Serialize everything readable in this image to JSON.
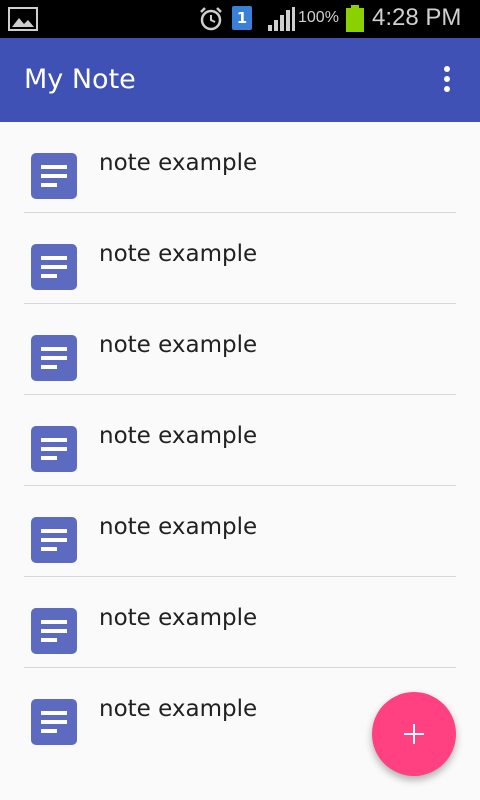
{
  "status_bar": {
    "battery_percent": "100%",
    "time": "4:28 PM",
    "sim_slot": "1",
    "icons": [
      "gallery-icon",
      "alarm-icon",
      "sim-icon",
      "signal-icon",
      "battery-icon"
    ]
  },
  "app_bar": {
    "title": "My Note",
    "overflow_icon": "more-vert-icon"
  },
  "notes": [
    {
      "title": "note example",
      "icon": "note-icon"
    },
    {
      "title": "note example",
      "icon": "note-icon"
    },
    {
      "title": "note example",
      "icon": "note-icon"
    },
    {
      "title": "note example",
      "icon": "note-icon"
    },
    {
      "title": "note example",
      "icon": "note-icon"
    },
    {
      "title": "note example",
      "icon": "note-icon"
    },
    {
      "title": "note example",
      "icon": "note-icon"
    }
  ],
  "fab": {
    "icon": "add-icon"
  },
  "colors": {
    "primary": "#3f51b5",
    "accent": "#ff4081",
    "note_icon": "#5c6bc0"
  }
}
